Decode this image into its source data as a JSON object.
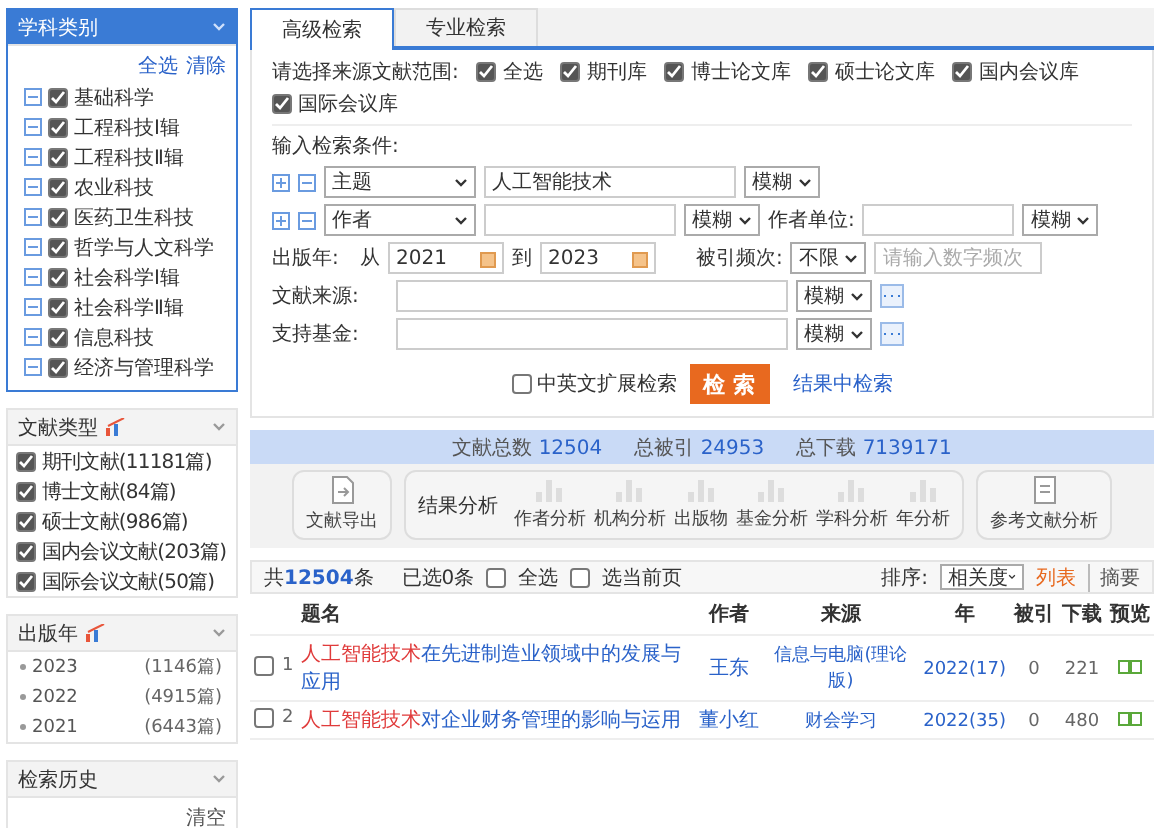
{
  "sidebar": {
    "subject_panel": {
      "title": "学科类别",
      "select_all": "全选",
      "clear": "清除",
      "items": [
        {
          "label": "基础科学",
          "checked": true
        },
        {
          "label": "工程科技Ⅰ辑",
          "checked": true
        },
        {
          "label": "工程科技Ⅱ辑",
          "checked": true
        },
        {
          "label": "农业科技",
          "checked": true
        },
        {
          "label": "医药卫生科技",
          "checked": true
        },
        {
          "label": "哲学与人文科学",
          "checked": true
        },
        {
          "label": "社会科学Ⅰ辑",
          "checked": true
        },
        {
          "label": "社会科学Ⅱ辑",
          "checked": true
        },
        {
          "label": "信息科技",
          "checked": true
        },
        {
          "label": "经济与管理科学",
          "checked": true
        }
      ]
    },
    "doc_type_panel": {
      "title": "文献类型",
      "items": [
        {
          "label": "期刊文献(11181篇)",
          "checked": true
        },
        {
          "label": "博士文献(84篇)",
          "checked": true
        },
        {
          "label": "硕士文献(986篇)",
          "checked": true
        },
        {
          "label": "国内会议文献(203篇)",
          "checked": true
        },
        {
          "label": "国际会议文献(50篇)",
          "checked": true
        }
      ]
    },
    "year_panel": {
      "title": "出版年",
      "items": [
        {
          "year": "2023",
          "count": "(1146篇)"
        },
        {
          "year": "2022",
          "count": "(4915篇)"
        },
        {
          "year": "2021",
          "count": "(6443篇)"
        }
      ]
    },
    "history_panel": {
      "title": "检索历史",
      "clear": "清空"
    }
  },
  "search": {
    "tabs": [
      {
        "label": "高级检索",
        "selected": true
      },
      {
        "label": "专业检索",
        "selected": false
      }
    ],
    "source_label": "请选择来源文献范围:",
    "sources": [
      {
        "label": "全选",
        "checked": true
      },
      {
        "label": "期刊库",
        "checked": true
      },
      {
        "label": "博士论文库",
        "checked": true
      },
      {
        "label": "硕士论文库",
        "checked": true
      },
      {
        "label": "国内会议库",
        "checked": true
      },
      {
        "label": "国际会议库",
        "checked": true
      }
    ],
    "conditions_label": "输入检索条件:",
    "conditions": [
      {
        "field": "主题",
        "value": "人工智能技术",
        "match": "模糊"
      },
      {
        "field": "作者",
        "match": "模糊",
        "extra_label": "作者单位:",
        "extra_match": "模糊"
      }
    ],
    "year_label": "出版年:",
    "from_label": "从",
    "from": "2021",
    "to_label": "到",
    "to": "2023",
    "cite_label": "被引频次:",
    "cite_value": "不限",
    "cite_placeholder": "请输入数字频次",
    "source_field_label": "文献来源:",
    "source_match": "模糊",
    "fund_label": "支持基金:",
    "fund_match": "模糊",
    "expand_label": "中英文扩展检索",
    "expand_checked": false,
    "search_button": "检 索",
    "in_results": "结果中检索"
  },
  "stats": [
    {
      "label": "文献总数",
      "value": "12504"
    },
    {
      "label": "总被引",
      "value": "24953"
    },
    {
      "label": "总下载",
      "value": "7139171"
    }
  ],
  "tools": {
    "export": "文献导出",
    "analysis_label": "结果分析",
    "analysis": [
      "作者分析",
      "机构分析",
      "出版物",
      "基金分析",
      "学科分析",
      "年分析"
    ],
    "reference": "参考文献分析"
  },
  "results": {
    "total_prefix": "共",
    "total": "12504",
    "total_suffix": "条",
    "selected": "已选0条",
    "select_all": "全选",
    "select_all_checked": false,
    "select_page": "选当前页",
    "select_page_checked": false,
    "sort_label": "排序:",
    "sort_value": "相关度",
    "views": [
      {
        "label": "列表",
        "selected": true
      },
      {
        "label": "摘要",
        "selected": false
      }
    ],
    "columns": [
      "题名",
      "作者",
      "来源",
      "年",
      "被引",
      "下载",
      "预览"
    ],
    "rows": [
      {
        "num": "1",
        "highlight": "人工智能技术",
        "rest": "在先进制造业领域中的发展与应用",
        "author": "王东",
        "source": "信息与电脑(理论版)",
        "year": "2022(17)",
        "cited": "0",
        "downloads": "221",
        "checked": false
      },
      {
        "num": "2",
        "highlight": "人工智能技术",
        "rest": "对企业财务管理的影响与运用",
        "author": "董小红",
        "source": "财会学习",
        "year": "2022(35)",
        "cited": "0",
        "downloads": "480",
        "checked": false
      }
    ]
  }
}
